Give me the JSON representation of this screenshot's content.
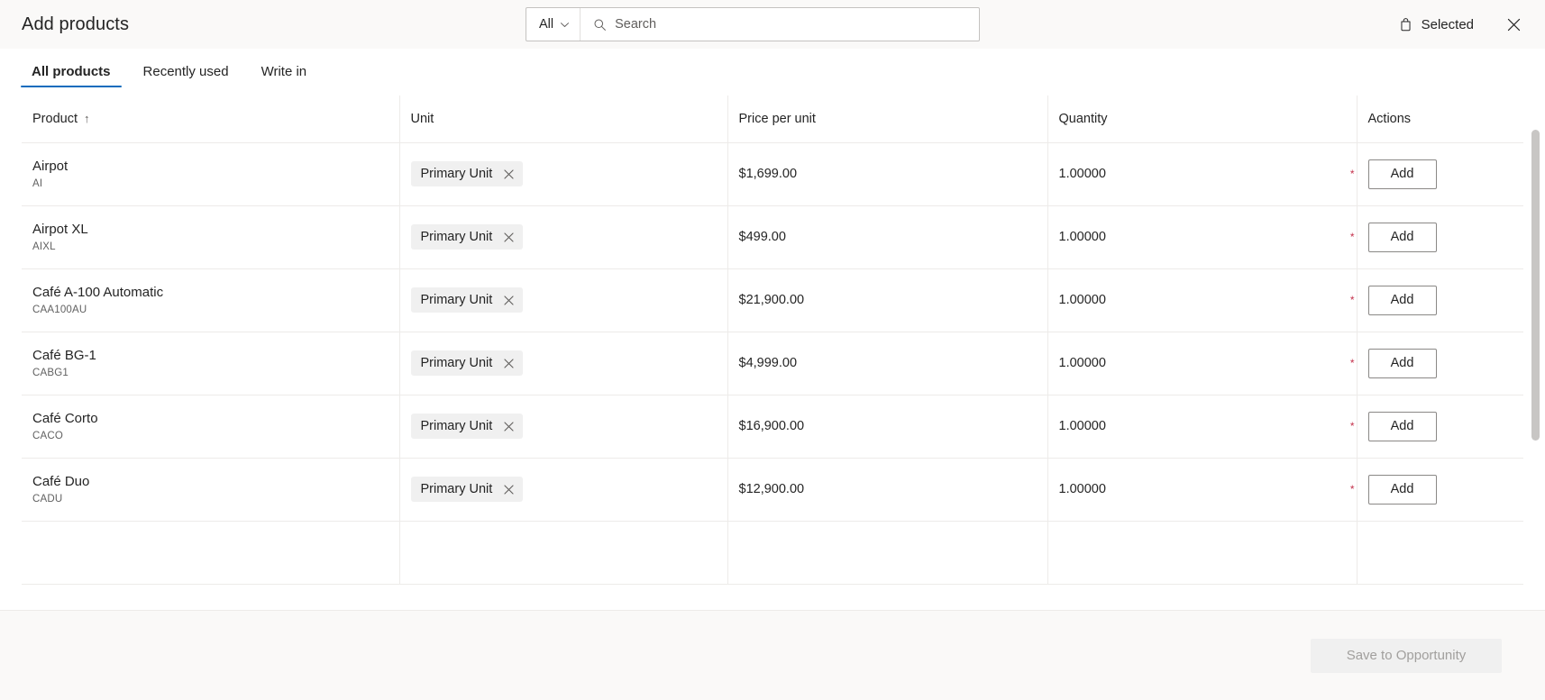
{
  "header": {
    "title": "Add products",
    "search": {
      "scope_label": "All",
      "scope_icon": "chevron-down-icon",
      "search_icon": "search-icon",
      "placeholder": "Search",
      "value": ""
    },
    "selected_label": "Selected",
    "selected_icon": "shopping-bag-icon",
    "close_icon": "close-icon"
  },
  "tabs": [
    {
      "label": "All products",
      "active": true
    },
    {
      "label": "Recently used",
      "active": false
    },
    {
      "label": "Write in",
      "active": false
    }
  ],
  "table": {
    "columns": [
      {
        "label": "Product",
        "sort_indicator": "↑"
      },
      {
        "label": "Unit",
        "sort_indicator": ""
      },
      {
        "label": "Price per unit",
        "sort_indicator": ""
      },
      {
        "label": "Quantity",
        "sort_indicator": ""
      },
      {
        "label": "Actions",
        "sort_indicator": ""
      }
    ],
    "rows": [
      {
        "product": "Airpot",
        "code": "AI",
        "unit": "Primary Unit",
        "price": "$1,699.00",
        "quantity": "1.00000",
        "required": "*",
        "action": "Add"
      },
      {
        "product": "Airpot XL",
        "code": "AIXL",
        "unit": "Primary Unit",
        "price": "$499.00",
        "quantity": "1.00000",
        "required": "*",
        "action": "Add"
      },
      {
        "product": "Café A-100 Automatic",
        "code": "CAA100AU",
        "unit": "Primary Unit",
        "price": "$21,900.00",
        "quantity": "1.00000",
        "required": "*",
        "action": "Add"
      },
      {
        "product": "Café BG-1",
        "code": "CABG1",
        "unit": "Primary Unit",
        "price": "$4,999.00",
        "quantity": "1.00000",
        "required": "*",
        "action": "Add"
      },
      {
        "product": "Café Corto",
        "code": "CACO",
        "unit": "Primary Unit",
        "price": "$16,900.00",
        "quantity": "1.00000",
        "required": "*",
        "action": "Add"
      },
      {
        "product": "Café Duo",
        "code": "CADU",
        "unit": "Primary Unit",
        "price": "$12,900.00",
        "quantity": "1.00000",
        "required": "*",
        "action": "Add"
      },
      {
        "product": "",
        "code": "",
        "unit": "",
        "price": "",
        "quantity": "",
        "required": "",
        "action": ""
      }
    ]
  },
  "footer": {
    "save_label": "Save to Opportunity",
    "save_disabled": true
  },
  "colors": {
    "accent": "#0f6cbd",
    "required": "#c4314b",
    "header_bg": "#faf9f8",
    "pill_bg": "#f0f0f0",
    "border": "#edebe9"
  }
}
